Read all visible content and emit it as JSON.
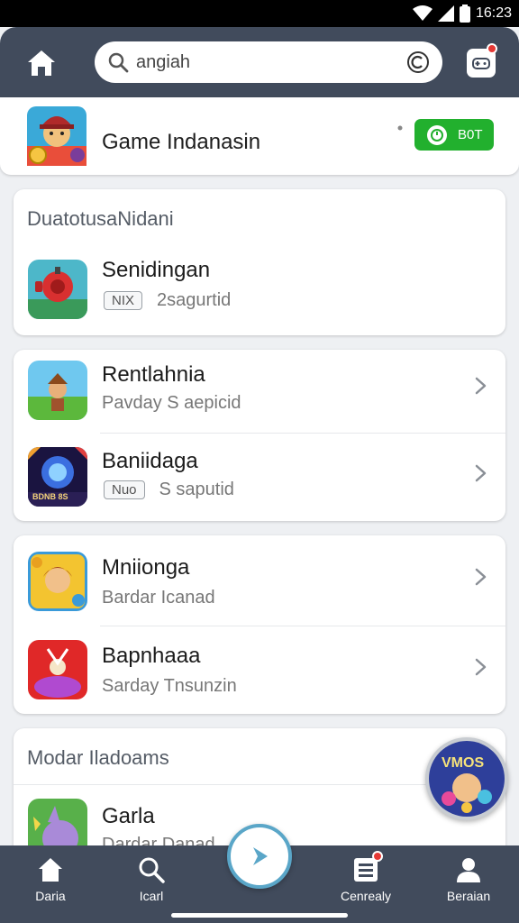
{
  "status_bar": {
    "time": "16:23"
  },
  "search": {
    "value": "angiah",
    "clear_icon": "clear-c-icon"
  },
  "featured": {
    "title": "Game Indanasin",
    "toggle_label": "B0T"
  },
  "section1": {
    "title": "DuatotusaNidani",
    "item": {
      "title": "Senidingan",
      "chip": "NIX",
      "sub": "2sagurtid"
    }
  },
  "section2": {
    "items": [
      {
        "title": "Rentlahnia",
        "sub": "Pavday S aepicid"
      },
      {
        "title": "Baniidaga",
        "chip": "Nuo",
        "sub": "S saputid"
      }
    ]
  },
  "section3": {
    "items": [
      {
        "title": "Mniionga",
        "sub": "Bardar Icanad"
      },
      {
        "title": "Bapnhaaa",
        "sub": "Sarday Tnsunzin"
      }
    ]
  },
  "section4": {
    "title": "Modar Iladoams",
    "item": {
      "title": "Garla",
      "sub": "Dardar Danad"
    }
  },
  "float_badge": {
    "label": "VMOS"
  },
  "game_icon_text": "BDNB  8S",
  "bottom_nav": {
    "items": [
      {
        "label": "Daria"
      },
      {
        "label": "Icarl"
      },
      {
        "label": "Cenrealy"
      },
      {
        "label": "Beraian"
      }
    ]
  },
  "colors": {
    "nav": "#414b5c",
    "accent_green": "#22b02e",
    "notify_red": "#e53935"
  }
}
